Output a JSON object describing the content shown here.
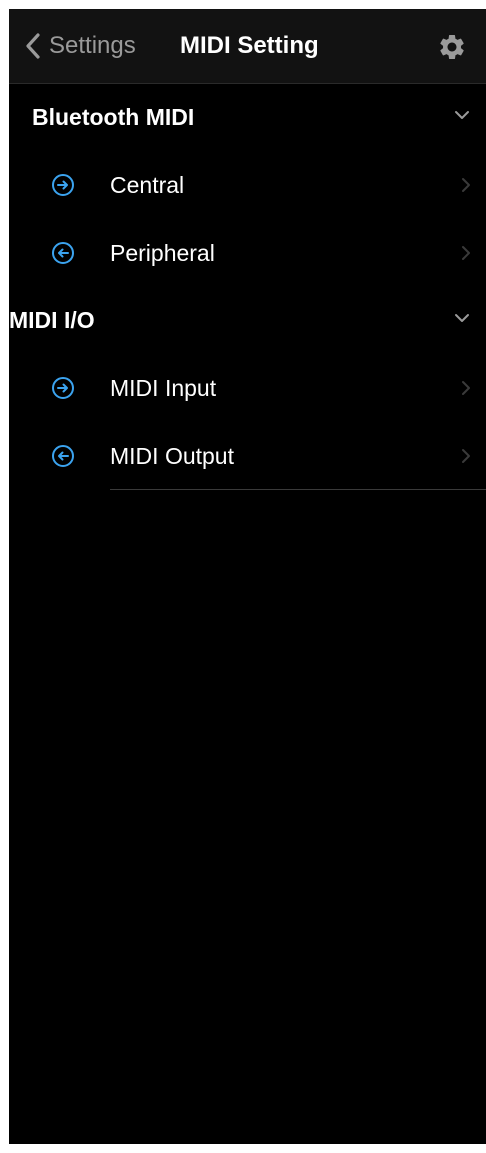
{
  "navbar": {
    "back_label": "Settings",
    "title": "MIDI Setting",
    "settings_icon": "gear-icon"
  },
  "sections": [
    {
      "title": "Bluetooth MIDI",
      "items": [
        {
          "label": "Central",
          "icon": "arrow-right-circle-icon"
        },
        {
          "label": "Peripheral",
          "icon": "arrow-left-circle-icon"
        }
      ]
    },
    {
      "title": "MIDI I/O",
      "items": [
        {
          "label": "MIDI Input",
          "icon": "arrow-right-circle-icon"
        },
        {
          "label": "MIDI Output",
          "icon": "arrow-left-circle-icon"
        }
      ]
    }
  ],
  "colors": {
    "background": "#000000",
    "navbar": "#121212",
    "accent": "#3ba3ef",
    "text": "#ffffff",
    "muted": "#9a9a9a"
  }
}
